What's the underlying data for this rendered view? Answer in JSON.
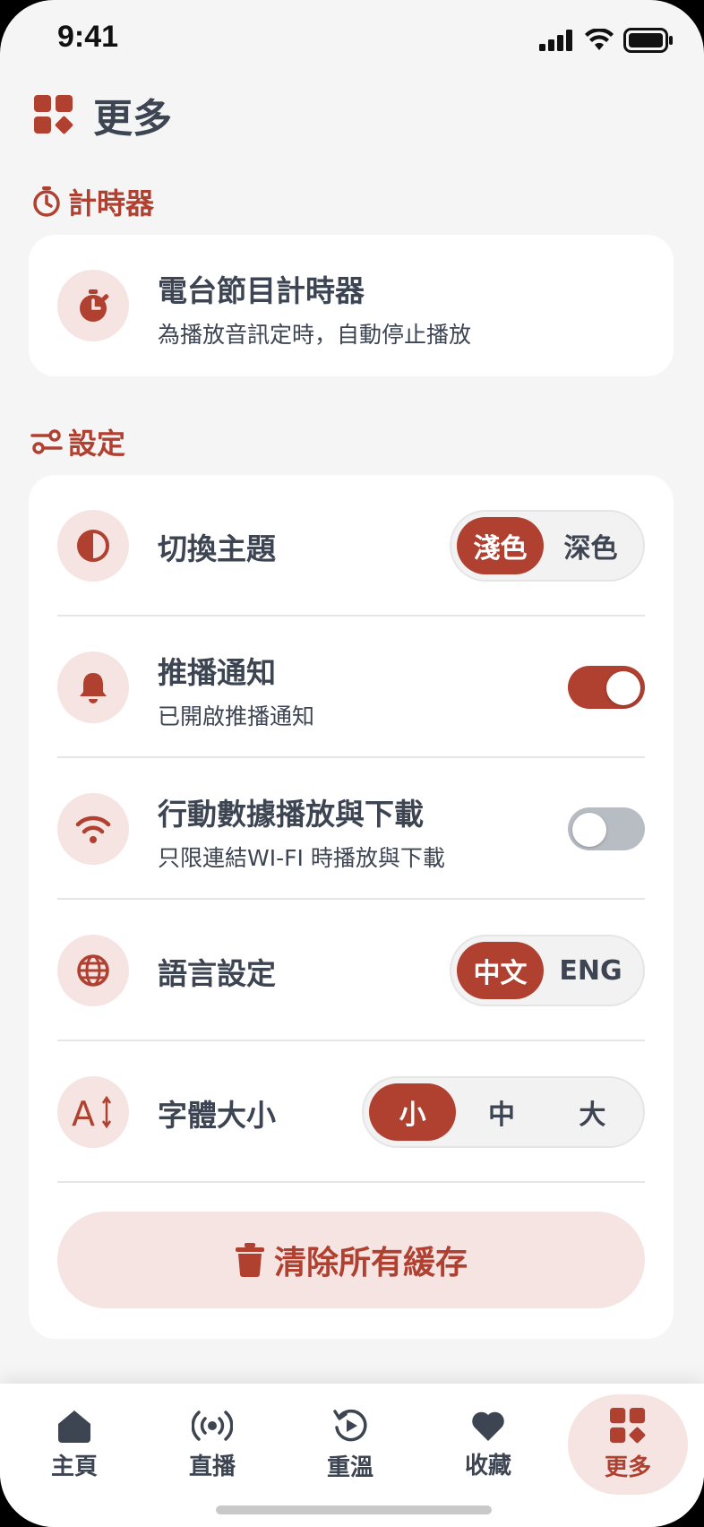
{
  "status": {
    "time": "9:41"
  },
  "header": {
    "title": "更多",
    "icon": "grid-icon"
  },
  "timer_section": {
    "title": "計時器",
    "item": {
      "label": "電台節目計時器",
      "sub": "為播放音訊定時，自動停止播放",
      "icon": "stopwatch-icon"
    }
  },
  "settings_section": {
    "title": "設定",
    "theme": {
      "label": "切換主題",
      "icon": "contrast-icon",
      "options": [
        "淺色",
        "深色"
      ],
      "selected": "淺色"
    },
    "push": {
      "label": "推播通知",
      "sub": "已開啟推播通知",
      "icon": "bell-icon",
      "enabled": true
    },
    "mobile_data": {
      "label": "行動數據播放與下載",
      "sub": "只限連結WI-FI 時播放與下載",
      "icon": "wifi-icon",
      "enabled": false
    },
    "language": {
      "label": "語言設定",
      "icon": "globe-icon",
      "options": [
        "中文",
        "ENG"
      ],
      "selected": "中文"
    },
    "font_size": {
      "label": "字體大小",
      "icon": "font-size-icon",
      "options": [
        "小",
        "中",
        "大"
      ],
      "selected": "小"
    },
    "clear_cache": {
      "label": "清除所有緩存",
      "icon": "trash-icon"
    }
  },
  "nav": [
    {
      "label": "主頁",
      "icon": "home-icon"
    },
    {
      "label": "直播",
      "icon": "broadcast-icon"
    },
    {
      "label": "重溫",
      "icon": "replay-icon"
    },
    {
      "label": "收藏",
      "icon": "heart-icon"
    },
    {
      "label": "更多",
      "icon": "grid-icon",
      "active": true
    }
  ],
  "colors": {
    "accent": "#b04030",
    "accent_soft": "#f5e4e2",
    "text": "#3d4452",
    "background": "#f5f5f5"
  }
}
